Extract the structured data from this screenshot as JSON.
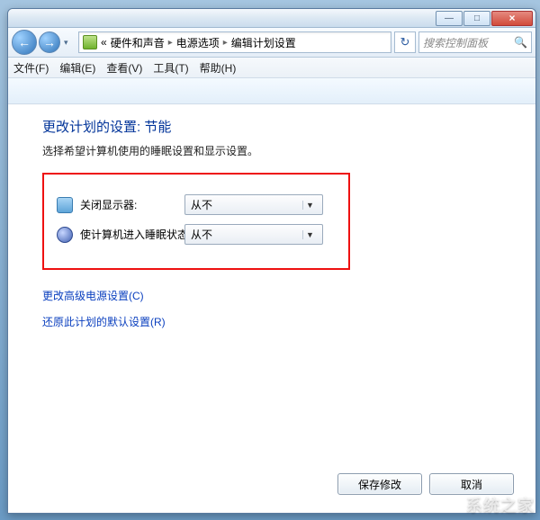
{
  "titlebar": {
    "min": "—",
    "max": "□",
    "close": "×"
  },
  "nav": {
    "back_arrow": "←",
    "fwd_arrow": "→",
    "chev": "▾",
    "crumb_prefix": "«",
    "crumb1": "硬件和声音",
    "crumb2": "电源选项",
    "crumb3": "编辑计划设置",
    "sep": "▸",
    "refresh": "↻",
    "search_placeholder": "搜索控制面板",
    "mag": "🔍"
  },
  "menu": {
    "file": "文件(F)",
    "edit": "编辑(E)",
    "view": "查看(V)",
    "tools": "工具(T)",
    "help": "帮助(H)"
  },
  "content": {
    "heading": "更改计划的设置: 节能",
    "subtext": "选择希望计算机使用的睡眠设置和显示设置。",
    "row1_label": "关闭显示器:",
    "row1_value": "从不",
    "row2_label": "使计算机进入睡眠状态:",
    "row2_value": "从不",
    "link_advanced": "更改高级电源设置(C)",
    "link_restore": "还原此计划的默认设置(R)",
    "save": "保存修改",
    "cancel": "取消",
    "dropdown_glyph": "▼"
  },
  "watermark": "系统之家"
}
